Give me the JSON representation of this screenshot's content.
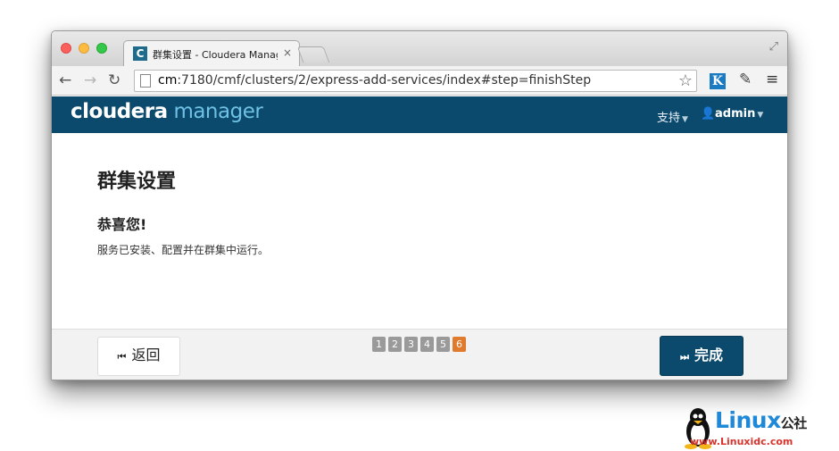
{
  "browser": {
    "tab_title": "群集设置 - Cloudera Manag",
    "tab_favicon": "C",
    "url_host": "cm",
    "url_rest": ":7180/cmf/clusters/2/express-add-services/index#step=finishStep",
    "extension_k": "K"
  },
  "app": {
    "logo_primary": "cloudera",
    "logo_secondary": "manager",
    "support_label": "支持",
    "user_label": "admin",
    "colors": {
      "header": "#0b4a6d",
      "accent": "#6ec1e4",
      "active_step": "#e07a2d"
    }
  },
  "content": {
    "title": "群集设置",
    "heading": "恭喜您!",
    "message": "服务已安装、配置并在群集中运行。"
  },
  "wizard": {
    "back_label": "返回",
    "finish_label": "完成",
    "steps": [
      "1",
      "2",
      "3",
      "4",
      "5",
      "6"
    ],
    "current_step": 6
  },
  "watermark": {
    "brand": "Linux",
    "brand_cn": "公社",
    "url": "www.Linuxidc.com"
  }
}
